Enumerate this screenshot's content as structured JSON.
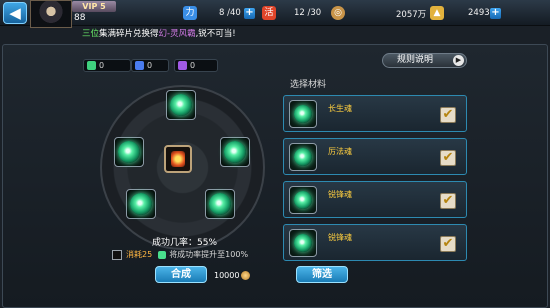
{
  "topbar": {
    "vip_label": "VIP 5",
    "player_level": "88",
    "resources": [
      {
        "icon": "lightning-icon",
        "glyph": "力",
        "color": "#3a8ee6",
        "value": "8 /40"
      },
      {
        "icon": "stamina-icon",
        "glyph": "活",
        "color": "#e0452a",
        "value": "12 /30"
      },
      {
        "icon": "copper-coin-icon",
        "glyph": "◎",
        "color": "#c89448",
        "value": "2057万"
      },
      {
        "icon": "gold-ingot-icon",
        "glyph": "▲",
        "color": "#e2b23d",
        "value": "2493"
      }
    ]
  },
  "marquee": {
    "part1": "三位",
    "part2": "集满碎片兑换得",
    "part3": "幻-灵风霸",
    "part4": ",锐不可当!"
  },
  "pills": [
    {
      "icon": "green-gem-icon",
      "color": "#3fd17e",
      "value": "0"
    },
    {
      "icon": "blue-gem-icon",
      "color": "#4a7cf0",
      "value": "0"
    },
    {
      "icon": "purple-gem-icon",
      "color": "#a15ae6",
      "value": "0"
    }
  ],
  "rules_button": "规则说明",
  "materials_title": "选择材料",
  "materials": [
    {
      "name": "长生魂",
      "checked": "✔"
    },
    {
      "name": "厉法魂",
      "checked": "✔"
    },
    {
      "name": "锐锋魂",
      "checked": "✔"
    },
    {
      "name": "锐锋魂",
      "checked": "✔"
    }
  ],
  "success_rate": "成功几率：55%",
  "consume": {
    "label": "消耗25",
    "boost_text": "将成功率提升至100%"
  },
  "craft_button": "合成",
  "craft_cost": "10000",
  "filter_button": "筛选"
}
